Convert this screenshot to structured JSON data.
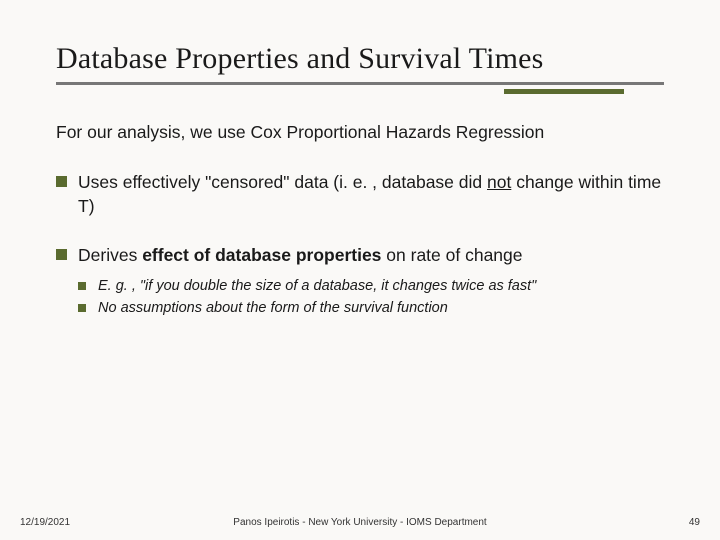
{
  "title": "Database Properties and Survival Times",
  "lead": "For our analysis, we use Cox Proportional Hazards Regression",
  "bullet1": {
    "pre": "Uses effectively \"censored\" data (i. e. , database did ",
    "not": "not",
    "post": " change within time T)"
  },
  "bullet2": {
    "pre": "Derives ",
    "strong": "effect of database properties",
    "post": " on rate of change"
  },
  "sub1": "E. g. , \"if you double the size of a database, it changes twice as fast\"",
  "sub2": "No assumptions about the form of the survival function",
  "footer": {
    "date": "12/19/2021",
    "center": "Panos Ipeirotis - New York University - IOMS Department",
    "page": "49"
  }
}
